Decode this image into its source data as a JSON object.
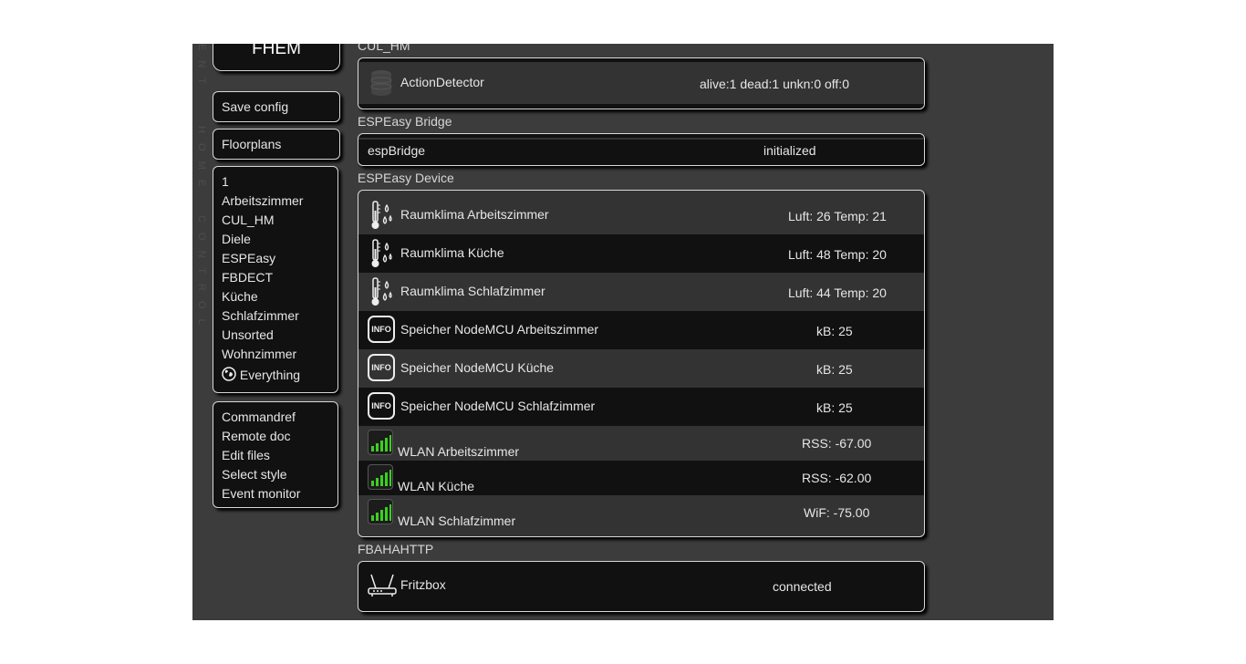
{
  "app": {
    "logo_text": "FHEM",
    "watermark": [
      "E N T",
      "H O M E",
      "C O N T R O L"
    ]
  },
  "menu": {
    "save_config": "Save config",
    "floorplans": "Floorplans",
    "rooms": [
      "1",
      "Arbeitszimmer",
      "CUL_HM",
      "Diele",
      "ESPEasy",
      "FBDECT",
      "Küche",
      "Schlafzimmer",
      "Unsorted",
      "Wohnzimmer"
    ],
    "everything": "Everything",
    "links": [
      "Commandref",
      "Remote doc",
      "Edit files",
      "Select style",
      "Event monitor"
    ]
  },
  "groups": {
    "cul_hm": {
      "title": "CUL_HM",
      "devices": [
        {
          "name": "ActionDetector",
          "state": "alive:1 dead:1 unkn:0 off:0",
          "icon": "database-icon"
        }
      ]
    },
    "espeasy_bridge": {
      "title": "ESPEasy Bridge",
      "devices": [
        {
          "name": "espBridge",
          "state": "initialized"
        }
      ]
    },
    "espeasy_device": {
      "title": "ESPEasy Device",
      "devices": [
        {
          "name": "Raumklima Arbeitszimmer",
          "state": "Luft: 26 Temp: 21",
          "icon": "thermometer-humidity-icon"
        },
        {
          "name": "Raumklima Küche",
          "state": "Luft: 48 Temp: 20",
          "icon": "thermometer-humidity-icon"
        },
        {
          "name": "Raumklima Schlafzimmer",
          "state": "Luft: 44 Temp: 20",
          "icon": "thermometer-humidity-icon"
        },
        {
          "name": "Speicher NodeMCU Arbeitszimmer",
          "state": "kB: 25",
          "icon": "info-icon",
          "icon_text": "INFO"
        },
        {
          "name": "Speicher NodeMCU Küche",
          "state": "kB: 25",
          "icon": "info-icon",
          "icon_text": "INFO"
        },
        {
          "name": "Speicher NodeMCU Schlafzimmer",
          "state": "kB: 25",
          "icon": "info-icon",
          "icon_text": "INFO"
        },
        {
          "name": "WLAN Arbeitszimmer",
          "state": "RSS: -67.00",
          "icon": "wlan-signal-icon"
        },
        {
          "name": "WLAN Küche",
          "state": "RSS: -62.00",
          "icon": "wlan-signal-icon"
        },
        {
          "name": "WLAN Schlafzimmer",
          "state": "WiF: -75.00",
          "icon": "wlan-signal-icon"
        }
      ]
    },
    "fbahahttp": {
      "title": "FBAHAHTTP",
      "devices": [
        {
          "name": "Fritzbox",
          "state": "connected",
          "icon": "router-icon"
        }
      ]
    }
  },
  "colors": {
    "background": "#3c3c3c",
    "block_bg": "#111111",
    "row_alt_bg": "#333333",
    "text": "#e6e6e6",
    "signal_green": "#3cd020"
  }
}
